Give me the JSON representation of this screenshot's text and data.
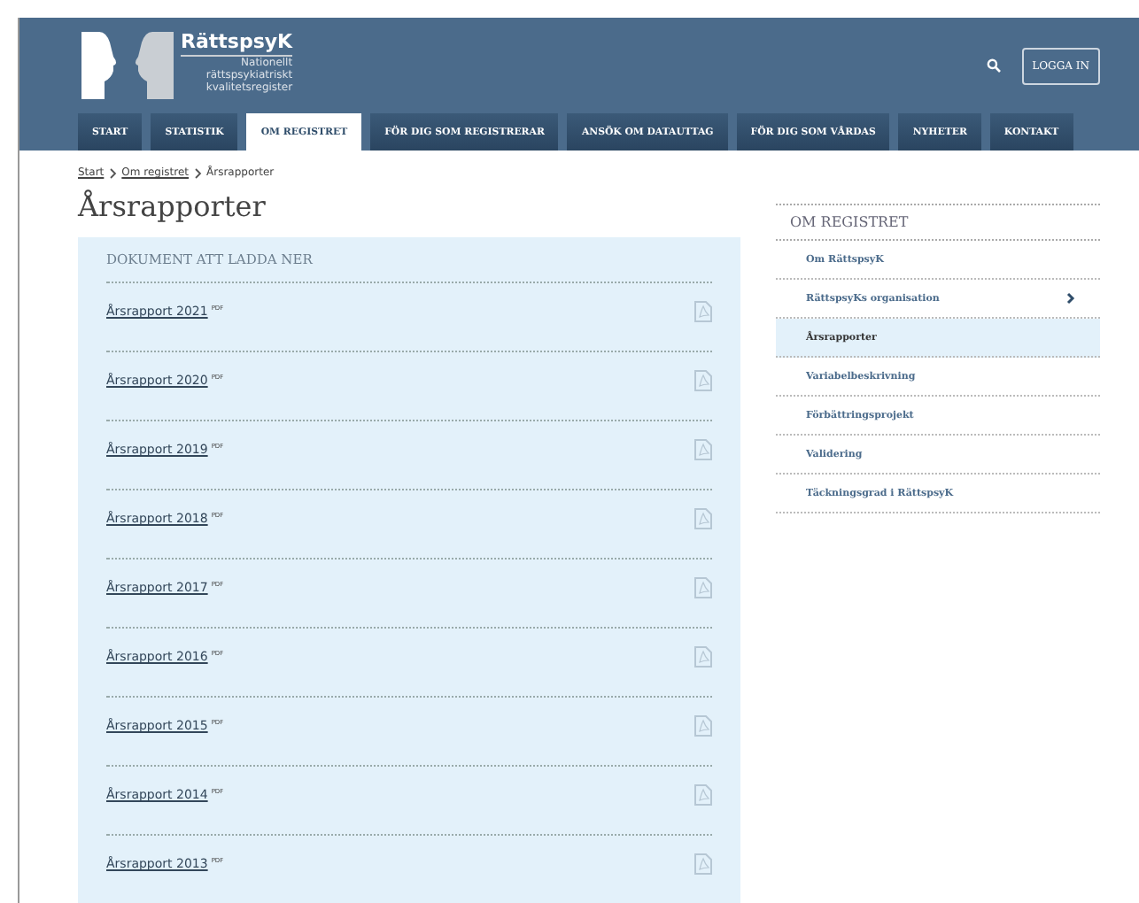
{
  "header": {
    "logo_title": "RättspsyK",
    "logo_subtitle": [
      "Nationellt",
      "rättspsykiatriskt",
      "kvalitetsregister"
    ],
    "login": "LOGGA IN"
  },
  "nav": [
    {
      "label": "START",
      "selected": false
    },
    {
      "label": "STATISTIK",
      "selected": false
    },
    {
      "label": "OM REGISTRET",
      "selected": true
    },
    {
      "label": "FÖR DIG SOM REGISTRERAR",
      "selected": false
    },
    {
      "label": "ANSÖK OM DATAUTTAG",
      "selected": false
    },
    {
      "label": "FÖR DIG SOM VÅRDAS",
      "selected": false
    },
    {
      "label": "NYHETER",
      "selected": false
    },
    {
      "label": "KONTAKT",
      "selected": false
    }
  ],
  "breadcrumb": [
    "Start",
    "Om registret",
    "Årsrapporter"
  ],
  "page_title": "Årsrapporter",
  "documents": {
    "heading": "DOKUMENT ATT LADDA NER",
    "items": [
      {
        "title": "Årsrapport 2021",
        "badge": "PDF"
      },
      {
        "title": "Årsrapport 2020",
        "badge": "PDF"
      },
      {
        "title": "Årsrapport 2019",
        "badge": "PDF"
      },
      {
        "title": "Årsrapport 2018",
        "badge": "PDF"
      },
      {
        "title": "Årsrapport 2017",
        "badge": "PDF"
      },
      {
        "title": "Årsrapport 2016",
        "badge": "PDF"
      },
      {
        "title": "Årsrapport 2015",
        "badge": "PDF"
      },
      {
        "title": "Årsrapport 2014",
        "badge": "PDF"
      },
      {
        "title": "Årsrapport 2013",
        "badge": "PDF"
      }
    ]
  },
  "sidebar": {
    "heading": "OM REGISTRET",
    "items": [
      {
        "label": "Om RättspsyK",
        "selected": false,
        "expandable": false
      },
      {
        "label": "RättspsyKs organisation",
        "selected": false,
        "expandable": true
      },
      {
        "label": "Årsrapporter",
        "selected": true,
        "expandable": false
      },
      {
        "label": "Variabelbeskrivning",
        "selected": false,
        "expandable": false
      },
      {
        "label": "Förbättringsprojekt",
        "selected": false,
        "expandable": false
      },
      {
        "label": "Validering",
        "selected": false,
        "expandable": false
      },
      {
        "label": "Täckningsgrad i RättspsyK",
        "selected": false,
        "expandable": false
      }
    ]
  }
}
